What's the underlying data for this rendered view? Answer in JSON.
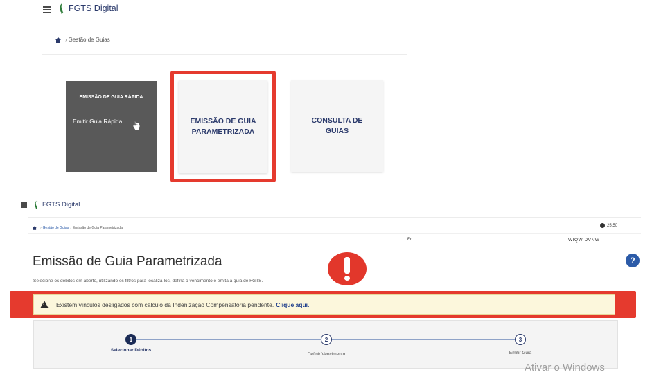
{
  "top": {
    "brand": "FGTS Digital",
    "breadcrumb": "Gestão de Guias",
    "cards": {
      "rapida_title": "EMISSÃO DE GUIA RÁPIDA",
      "rapida_link": "Emitir Guia Rápida",
      "parametrizada": "EMISSÃO DE GUIA PARAMETRIZADA",
      "consulta": "CONSULTA DE GUIAS"
    }
  },
  "lower": {
    "brand": "FGTS Digital",
    "breadcrumb": [
      "Gestão de Guias",
      "Emissão de Guia Parametrizada"
    ],
    "time": "25:50",
    "en_text": "En",
    "wiqw_text": "WIQW DVNW",
    "page_title": "Emissão de Guia Parametrizada",
    "subtitle": "Selecione os débitos em aberto, utilizando os filtros para localizá-los, defina o vencimento e emita a guia de FGTS.",
    "alert": {
      "text": "Existem vínculos desligados com cálculo da Indenização Compensatória pendente.",
      "link": "Clique aqui."
    },
    "help": "?",
    "steps": [
      {
        "number": "1",
        "label": "Selecionar Débitos"
      },
      {
        "number": "2",
        "label": "Definir Vencimento"
      },
      {
        "number": "3",
        "label": "Emitir Guia"
      }
    ]
  },
  "watermark": "Ativar o Windows",
  "colors": {
    "highlight": "#e53a2e",
    "brand_blue": "#2b3a6b",
    "warning_bg": "#fcf7dc"
  },
  "icons": {
    "menu": "hamburger-icon",
    "home": "home-icon",
    "alert": "warning-icon",
    "help": "question-icon"
  }
}
